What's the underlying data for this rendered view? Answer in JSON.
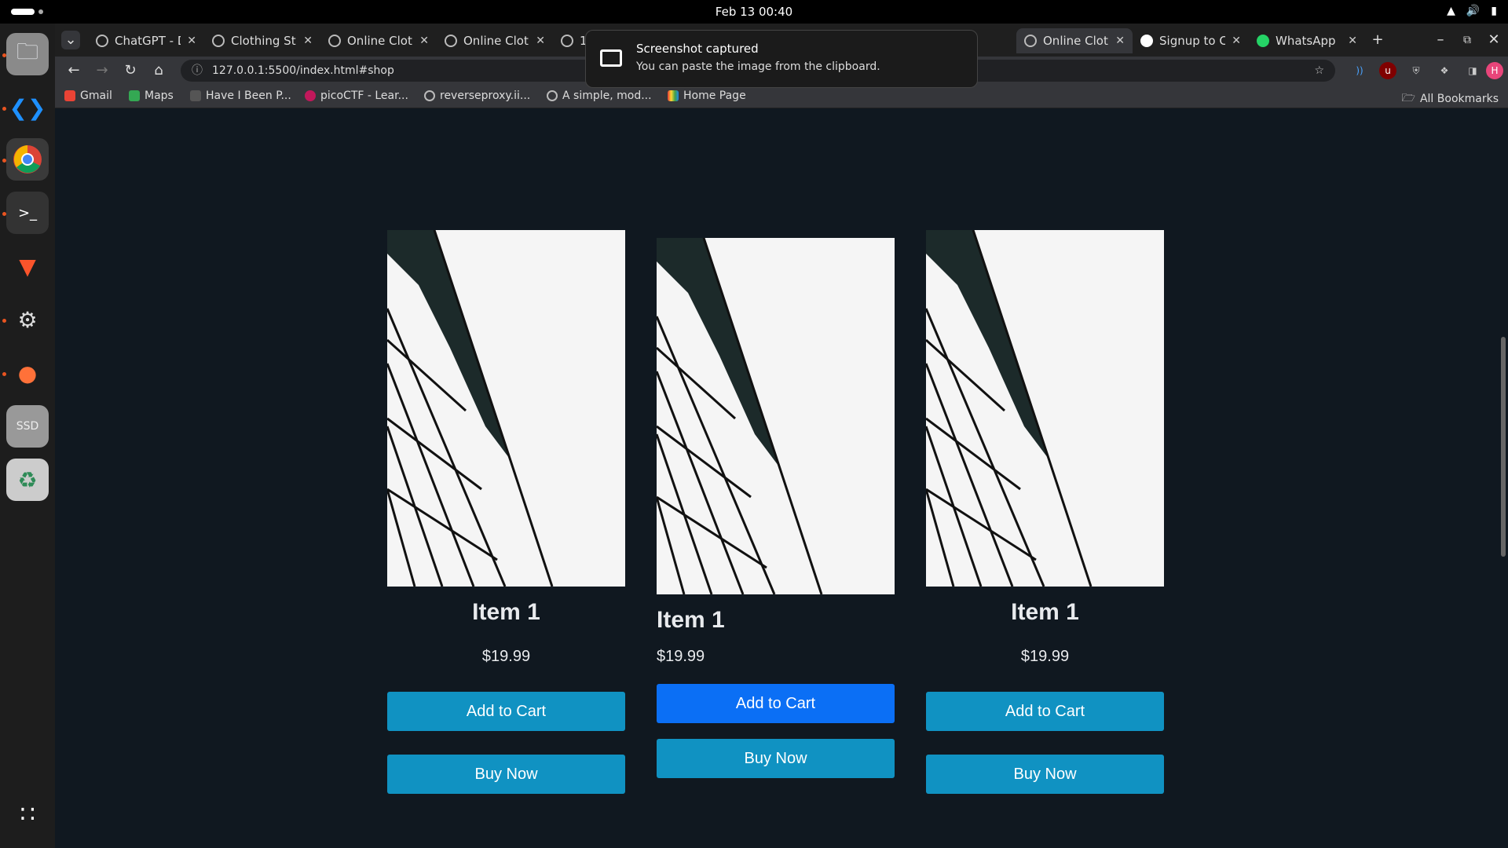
{
  "system_bar": {
    "clock": "Feb 13  00:40"
  },
  "tabs": [
    {
      "title": "ChatGPT - D"
    },
    {
      "title": "Clothing St"
    },
    {
      "title": "Online Clot"
    },
    {
      "title": "Online Clot"
    },
    {
      "title": "1"
    },
    {
      "title": "Online Clot",
      "active": true
    },
    {
      "title": "Signup to C"
    },
    {
      "title": "WhatsApp"
    }
  ],
  "address_bar": {
    "url": "127.0.0.1:5500/index.html#shop"
  },
  "bookmarks": [
    "Gmail",
    "Maps",
    "Have I Been P...",
    "picoCTF - Lear...",
    "reverseproxy.ii...",
    "A simple, mod...",
    "Home Page"
  ],
  "all_bookmarks_label": "All Bookmarks",
  "notification": {
    "title": "Screenshot captured",
    "body": "You can paste the image from the clipboard."
  },
  "products": [
    {
      "name": "Item 1",
      "price": "$19.99",
      "add_to_cart": "Add to Cart",
      "buy_now": "Buy Now"
    },
    {
      "name": "Item 1",
      "price": "$19.99",
      "add_to_cart": "Add to Cart",
      "buy_now": "Buy Now"
    },
    {
      "name": "Item 1",
      "price": "$19.99",
      "add_to_cart": "Add to Cart",
      "buy_now": "Buy Now"
    }
  ],
  "colors": {
    "page_bg": "#101820",
    "button": "#1092c2",
    "button_hover": "#0b6ff5"
  },
  "dock_icons": [
    "files-icon",
    "vscode-icon",
    "chrome-icon",
    "terminal-icon",
    "brave-icon",
    "settings-icon",
    "firefox-icon",
    "ssd-icon",
    "trash-icon",
    "app-grid-icon"
  ]
}
